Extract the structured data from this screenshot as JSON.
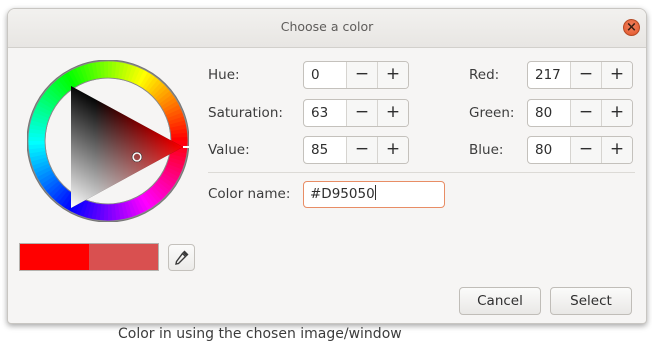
{
  "window": {
    "title": "Choose a color",
    "close_glyph": "×"
  },
  "hsv": {
    "hue": {
      "label": "Hue:",
      "value": "0"
    },
    "saturation": {
      "label": "Saturation:",
      "value": "63"
    },
    "value": {
      "label": "Value:",
      "value": "85"
    }
  },
  "rgb": {
    "red": {
      "label": "Red:",
      "value": "217"
    },
    "green": {
      "label": "Green:",
      "value": "80"
    },
    "blue": {
      "label": "Blue:",
      "value": "80"
    }
  },
  "spin_glyphs": {
    "decrement": "−",
    "increment": "+"
  },
  "color_name": {
    "label": "Color name:",
    "value": "#D95050"
  },
  "preview": {
    "old_color": "#ff0000",
    "new_color": "#d95050"
  },
  "buttons": {
    "cancel": "Cancel",
    "select": "Select"
  },
  "icons": {
    "close": "close-icon",
    "picker": "eyedropper-icon"
  },
  "background_text": "Color in using the chosen image/window"
}
